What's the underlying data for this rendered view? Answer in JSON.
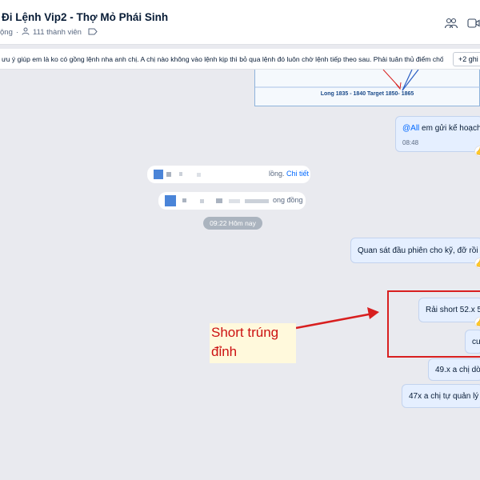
{
  "header": {
    "title": "Đi Lệnh Vip2 - Thợ Mỏ Phái Sinh",
    "status_text": "ộng",
    "separator": "·",
    "members": "111 thành viên"
  },
  "pinned": {
    "text": "ưu ý giúp em là ko có gồng lệnh nha anh chị. A chị nào không vào lệnh kịp thì bỏ qua lệnh đó luôn chờ lệnh tiếp theo sau. Phải tuân thủ điểm chốt lời ...",
    "more_label": "+2 ghi"
  },
  "chart_image": {
    "caption": "Long 1835 - 1840  Target 1850- 1865"
  },
  "messages": {
    "plan_mention": "@All",
    "plan_text": " em gửi kế hoạch h",
    "plan_time": "08:48",
    "observe_text": "Quan sát đầu phiên cho kỹ, đỡ rồi nh",
    "short_text": "Rải short 52.x 54",
    "cu_text": "cư",
    "buy_text": "49.x a chị dời",
    "manage_text": "47x a chị tự quản lý lơ"
  },
  "system": {
    "sys1_text": "lồng. ",
    "sys1_link": "Chi tiết",
    "sys2_text": "ong đồng"
  },
  "timestamp": "09:22 Hôm nay",
  "annotation": {
    "line1": "Short trúng",
    "line2": "đỉnh",
    "color": "#cc1111"
  },
  "icons": [
    "people-icon",
    "video-call-icon",
    "tag-icon",
    "member-icon"
  ]
}
